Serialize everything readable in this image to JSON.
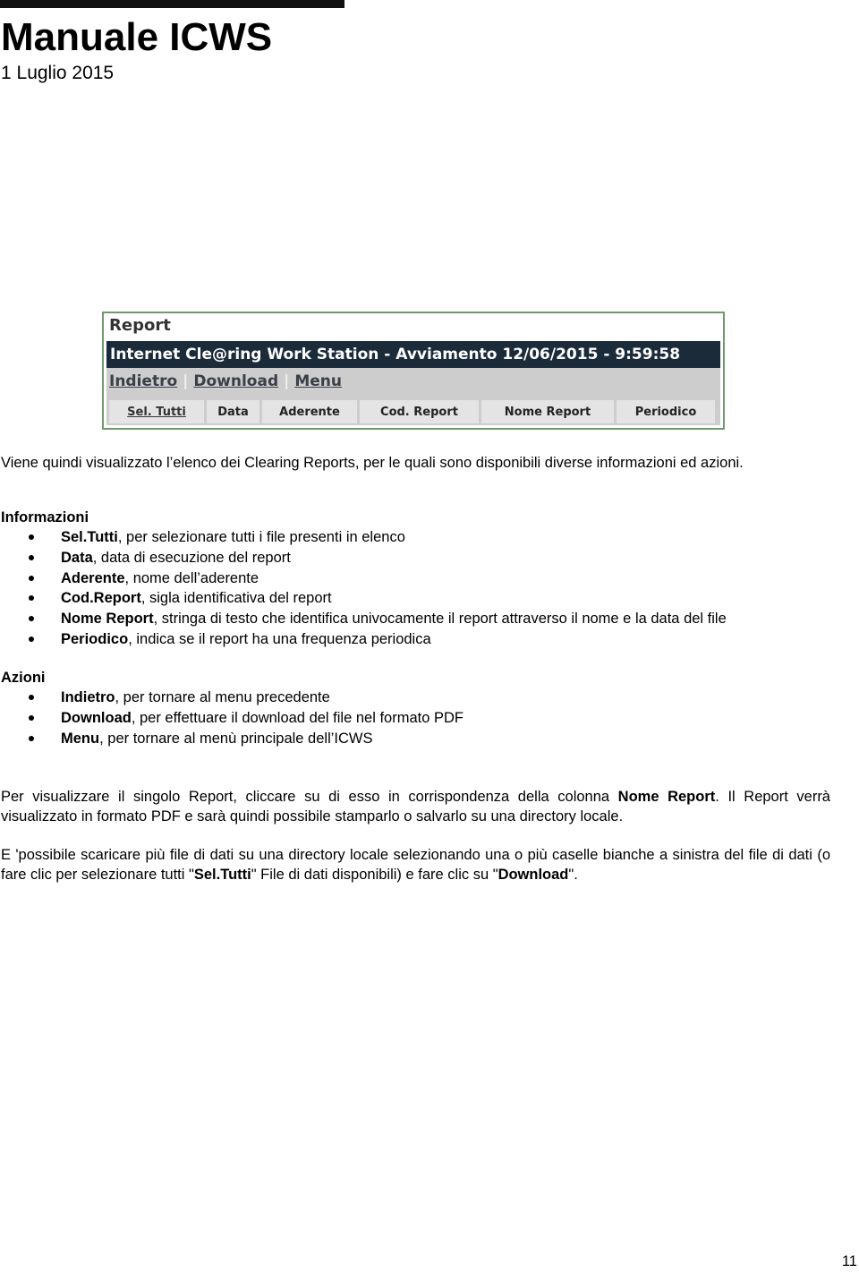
{
  "header": {
    "title": "Manuale ICWS",
    "date": "1 Luglio 2015"
  },
  "screenshot": {
    "window_title": "Report",
    "banner": "Internet Cle@ring Work Station - Avviamento 12/06/2015 - 9:59:58",
    "nav_links": [
      "Indietro",
      "Download",
      "Menu"
    ],
    "columns": [
      "Sel. Tutti",
      "Data",
      "Aderente",
      "Cod. Report",
      "Nome Report",
      "Periodico"
    ]
  },
  "intro": "Viene quindi visualizzato l’elenco dei Clearing Reports, per le quali sono disponibili diverse informazioni ed azioni.",
  "informazioni": {
    "heading": "Informazioni",
    "items": [
      {
        "term": "Sel.Tutti",
        "desc": ", per selezionare tutti i file presenti in elenco"
      },
      {
        "term": "Data",
        "desc": ", data di esecuzione del report"
      },
      {
        "term": "Aderente",
        "desc": ", nome dell’aderente"
      },
      {
        "term": "Cod.Report",
        "desc": ", sigla identificativa del report"
      },
      {
        "term": "Nome Report",
        "desc": ", stringa di testo che identifica univocamente il report attraverso il nome e la data del file"
      },
      {
        "term": "Periodico",
        "desc": ", indica se il report ha una frequenza periodica"
      }
    ]
  },
  "azioni": {
    "heading": "Azioni",
    "items": [
      {
        "term": "Indietro",
        "desc": ", per tornare al menu precedente"
      },
      {
        "term": "Download",
        "desc": ", per effettuare il download del file nel formato PDF"
      },
      {
        "term": "Menu",
        "desc": ", per tornare al menù principale dell’ICWS"
      }
    ]
  },
  "para1": {
    "a": "Per visualizzare il singolo Report, cliccare su di esso in corrispondenza della colonna ",
    "b": "Nome Report",
    "c": ". Il Report verrà visualizzato in formato PDF e sarà quindi possibile stamparlo o salvarlo su una directory locale."
  },
  "para2": {
    "a": "E 'possibile scaricare più file di dati su una directory locale selezionando una o più caselle bianche a sinistra del file di dati (o fare clic per selezionare tutti \"",
    "b": "Sel.Tutti",
    "c": "\" File di dati disponibili) e fare clic su \"",
    "d": "Download",
    "e": "\"."
  },
  "page_number": "11"
}
